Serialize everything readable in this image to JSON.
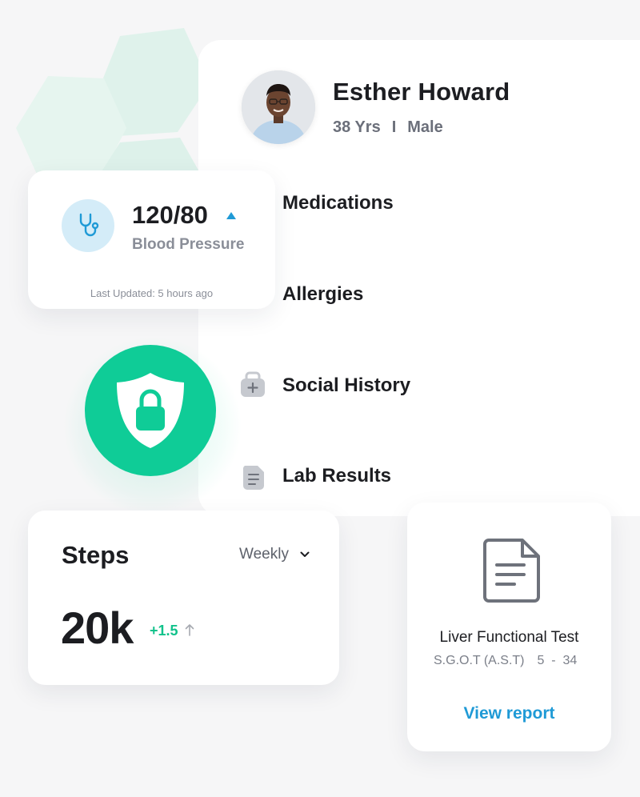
{
  "patient": {
    "name": "Esther Howard",
    "age": "38 Yrs",
    "separator": "I",
    "gender": "Male"
  },
  "menu": [
    {
      "label": "Medications",
      "icon": "pill-icon"
    },
    {
      "label": "Allergies",
      "icon": "allergy-icon"
    },
    {
      "label": "Social History",
      "icon": "medical-bag-icon"
    },
    {
      "label": "Lab Results",
      "icon": "document-icon"
    }
  ],
  "blood_pressure": {
    "value": "120/80",
    "trend": "up",
    "label": "Blood Pressure",
    "updated": "Last Updated: 5 hours ago"
  },
  "steps": {
    "title": "Steps",
    "period": "Weekly",
    "value": "20k",
    "change": "+1.5"
  },
  "lab_card": {
    "title": "Liver Functional Test",
    "test": "S.G.O.T (A.S.T)",
    "range": "5  -  34",
    "link": "View report"
  },
  "colors": {
    "accent_green": "#0fcc97",
    "accent_blue": "#1f9ad6",
    "hex_tint": "#dff3ec"
  }
}
